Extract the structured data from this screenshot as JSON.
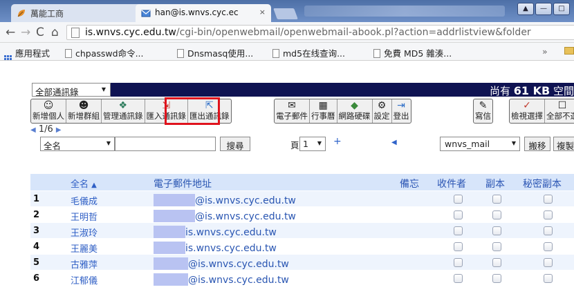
{
  "browser": {
    "tabs": [
      {
        "label": "萬能工商",
        "active": false
      },
      {
        "label": "han@is.wnvs.cyc.ec",
        "active": true
      }
    ],
    "tab_close": "×",
    "window_buttons": [
      "▲",
      "—",
      "□"
    ],
    "url_host": "is.wnvs.cyc.edu.tw",
    "url_path": "/cgi-bin/openwebmail/openwebmail-abook.pl?action=addrlistview&folder",
    "bookmarks": [
      "應用程式",
      "chpasswd命令...",
      "Dnsmasq使用...",
      "md5在线查询...",
      "免費 MD5 雜湊..."
    ],
    "bookmarks_overflow": "»"
  },
  "page": {
    "book_select": "全部通訊錄",
    "quota_prefix": "尚有",
    "quota_value": "61 KB",
    "quota_suffix": "空間",
    "toolbar_groups": [
      [
        {
          "label": "新增個人",
          "icon": "add-person-icon"
        },
        {
          "label": "新增群組",
          "icon": "add-group-icon"
        },
        {
          "label": "管理通訊錄",
          "icon": "manage-book-icon"
        },
        {
          "label": "匯入通訊錄",
          "icon": "import-book-icon"
        },
        {
          "label": "匯出通訊錄",
          "icon": "export-book-icon"
        }
      ],
      [
        {
          "label": "電子郵件",
          "icon": "mail-icon"
        },
        {
          "label": "行事曆",
          "icon": "calendar-icon"
        },
        {
          "label": "網路硬碟",
          "icon": "drive-icon"
        },
        {
          "label": "設定",
          "icon": "settings-icon"
        },
        {
          "label": "登出",
          "icon": "logout-icon"
        }
      ],
      [
        {
          "label": "寫信",
          "icon": "compose-icon"
        }
      ],
      [
        {
          "label": "檢視選擇",
          "icon": "view-selection-icon"
        },
        {
          "label": "全部不選",
          "icon": "deselect-all-icon"
        }
      ]
    ],
    "pager": "1/6",
    "search": {
      "field": "全名",
      "query": "",
      "search_label": "搜尋",
      "page_label": "頁",
      "page_value": "1",
      "plus": "+",
      "folder": "wnvs_mail",
      "move_label": "搬移",
      "copy_label": "複製"
    },
    "table": {
      "headers": {
        "name": "全名",
        "sort": "▲",
        "email": "電子郵件地址",
        "memo": "備忘",
        "to": "收件者",
        "cc": "副本",
        "bcc": "秘密副本"
      },
      "rows": [
        {
          "num": "1",
          "name": "毛儀成",
          "email": "@is.wnvs.cyc.edu.tw"
        },
        {
          "num": "2",
          "name": "王明哲",
          "email": "@is.wnvs.cyc.edu.tw"
        },
        {
          "num": "3",
          "name": "王淑玲",
          "email": "is.wnvs.cyc.edu.tw"
        },
        {
          "num": "4",
          "name": "王麗美",
          "email": "is.wnvs.cyc.edu.tw"
        },
        {
          "num": "5",
          "name": "古雅萍",
          "email": "@is.wnvs.cyc.edu.tw"
        },
        {
          "num": "6",
          "name": "江郁儀",
          "email": "@is.wnvs.cyc.edu.tw"
        }
      ]
    }
  },
  "colors": {
    "quota_bar": "#0f1352",
    "highlight_box": "#e0121c",
    "header_row": "#d7e5fa",
    "odd_row": "#eef4fd",
    "link": "#2f5fc5",
    "redaction": "#b9c3f2"
  }
}
